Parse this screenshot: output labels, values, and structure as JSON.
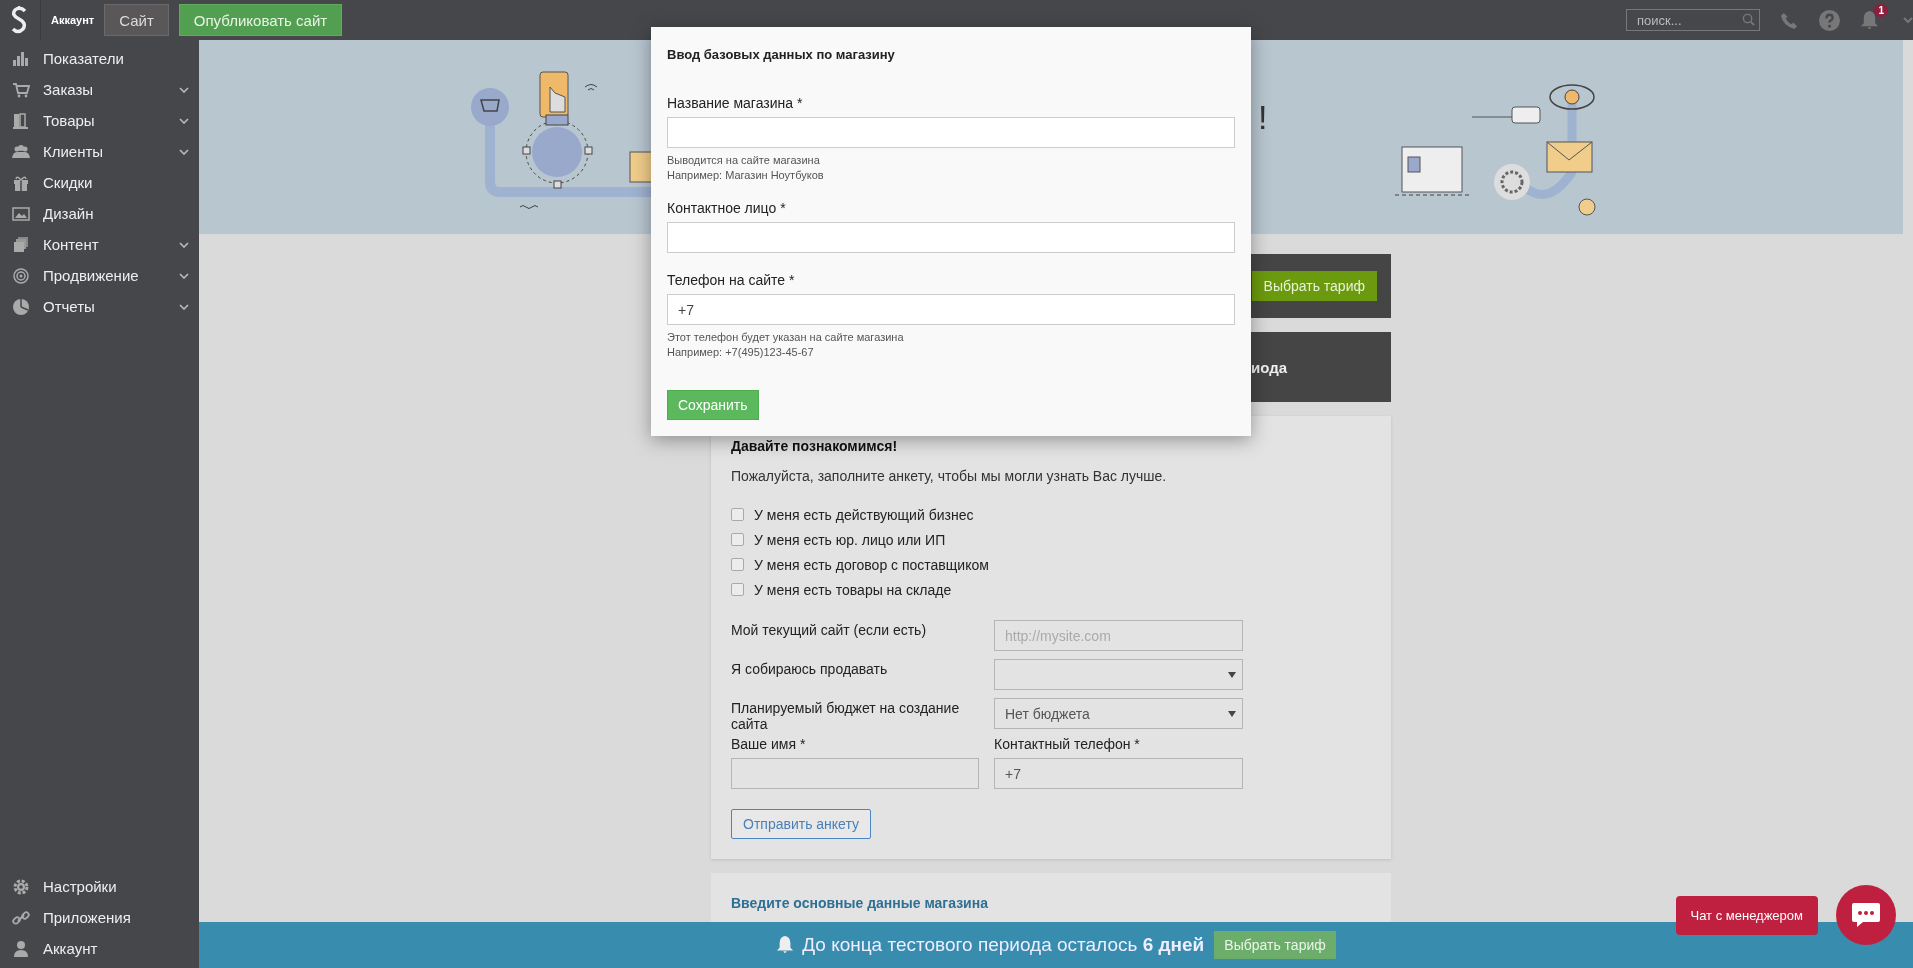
{
  "topbar": {
    "account_label": "Аккаунт",
    "site_button": "Сайт",
    "publish_button": "Опубликовать сайт",
    "search": {
      "placeholder": "поиск..."
    },
    "notification_count": "1"
  },
  "sidebar": {
    "items": [
      {
        "label": "Показатели",
        "has_submenu": false
      },
      {
        "label": "Заказы",
        "has_submenu": true
      },
      {
        "label": "Товары",
        "has_submenu": true
      },
      {
        "label": "Клиенты",
        "has_submenu": true
      },
      {
        "label": "Скидки",
        "has_submenu": false
      },
      {
        "label": "Дизайн",
        "has_submenu": false
      },
      {
        "label": "Контент",
        "has_submenu": true
      },
      {
        "label": "Продвижение",
        "has_submenu": true
      },
      {
        "label": "Отчеты",
        "has_submenu": true
      }
    ],
    "bottom_items": [
      {
        "label": "Настройки"
      },
      {
        "label": "Приложения"
      },
      {
        "label": "Аккаунт"
      }
    ]
  },
  "banner": {
    "heading_fragment": "!"
  },
  "tariff_card": {
    "button": "Выбрать тариф"
  },
  "trial_card": {
    "text_fragment": "иода"
  },
  "survey": {
    "title": "Давайте познакомимся!",
    "intro": "Пожалуйста, заполните анкету, чтобы мы могли узнать Вас лучше.",
    "checkboxes": [
      {
        "label": "У меня есть действующий бизнес",
        "checked": false
      },
      {
        "label": "У меня есть юр. лицо или ИП",
        "checked": false
      },
      {
        "label": "У меня есть договор с поставщиком",
        "checked": false
      },
      {
        "label": "У меня есть товары на складе",
        "checked": false
      }
    ],
    "fields": [
      {
        "kind": "text",
        "label": "Мой текущий сайт (если есть)",
        "placeholder": "http://mysite.com"
      },
      {
        "kind": "select",
        "label": "Я собираюсь продавать"
      },
      {
        "kind": "select",
        "label": "Планируемый бюджет на создание сайта",
        "value": "Нет бюджета"
      }
    ],
    "name_field": {
      "label": "Ваше имя *"
    },
    "phone_field": {
      "label": "Контактный телефон *",
      "value": "+7"
    },
    "submit_button": "Отправить анкету"
  },
  "store_card": {
    "title": "Введите основные данные магазина"
  },
  "modal": {
    "title": "Ввод базовых данных по магазину",
    "fields": [
      {
        "label": "Название магазина *",
        "hints": [
          "Выводится на сайте магазина",
          "Например: Магазин Ноутбуков"
        ]
      },
      {
        "label": "Контактное лицо *"
      },
      {
        "label": "Телефон на сайте *",
        "value": "+7",
        "hints": [
          "Этот телефон будет указан на сайте магазина",
          "Например: +7(495)123-45-67"
        ]
      }
    ],
    "save_button": "Сохранить"
  },
  "trial_bar": {
    "text": "До конца тестового периода осталось **6 дней**",
    "button": "Выбрать тариф"
  },
  "chat": {
    "label": "Чат с менеджером"
  }
}
